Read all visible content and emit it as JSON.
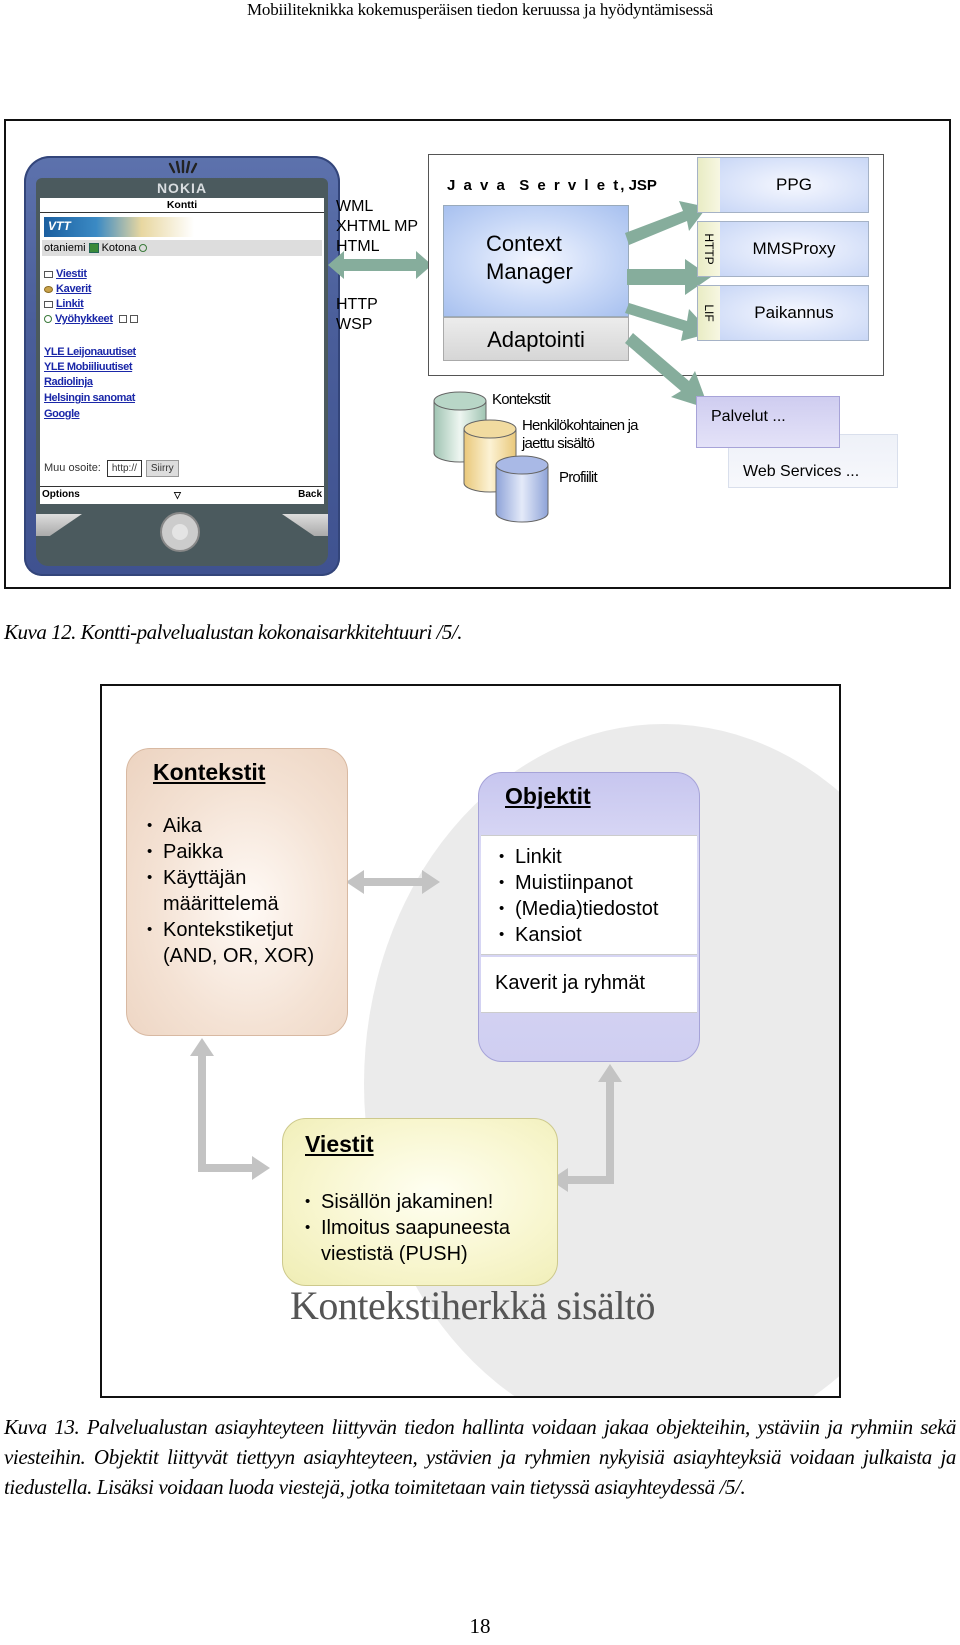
{
  "page": {
    "running_header": "Mobiiliteknikka kokemusperäisen tiedon keruussa ja hyödyntämisessä",
    "page_number": "18"
  },
  "figure12": {
    "phone": {
      "brand": "NOKIA",
      "screen_title": "Kontti",
      "logo": "VTT",
      "location": "otaniemi",
      "status": "Kotona",
      "menu": [
        {
          "label": "Viestit",
          "icon": "envelope-icon"
        },
        {
          "label": "Kaverit",
          "icon": "friends-icon"
        },
        {
          "label": "Linkit",
          "icon": "folder-icon"
        },
        {
          "label": "Vyöhykkeet",
          "icon": "zone-icon"
        }
      ],
      "links": [
        "YLE Leijonauutiset",
        "YLE Mobiiliuutiset",
        "Radiolinja",
        "Helsingin sanomat",
        "Google"
      ],
      "address_label": "Muu osoite:",
      "address_value": "http://",
      "go_button": "Siirry",
      "softkey_left": "Options",
      "softkey_right": "Back"
    },
    "protocols_top": [
      "WML",
      "XHTML MP",
      "HTML"
    ],
    "protocols_bottom": [
      "HTTP",
      "WSP"
    ],
    "servlet_title_spaced": "J a v a  S e r v l e t",
    "servlet_title_rest": ", JSP",
    "context_manager": [
      "Context",
      "Manager"
    ],
    "adaptointi": "Adaptointi",
    "services": [
      {
        "tab": "",
        "label": "PPG"
      },
      {
        "tab": "HTTP",
        "label": "MMSProxy"
      },
      {
        "tab": "LIF",
        "label": "Paikannus"
      }
    ],
    "databases": {
      "kontekstit": "Kontekstit",
      "sisalto": [
        "Henkilökohtainen ja",
        "jaettu sisältö"
      ],
      "profiilit": "Profiilit"
    },
    "palvelut": "Palvelut ...",
    "web_services": "Web Services ...",
    "caption": "Kuva 12. Kontti-palvelualustan kokonaisarkkitehtuuri /5/."
  },
  "figure13": {
    "kontekstit": {
      "title": "Kontekstit",
      "items": [
        "Aika",
        "Paikka",
        "Käyttäjän määrittelemä",
        "Kontekstiketjut (AND, OR, XOR)"
      ]
    },
    "objektit": {
      "title": "Objektit",
      "items": [
        "Linkit",
        "Muistiinpanot",
        "(Media)tiedostot",
        "Kansiot"
      ],
      "friends": "Kaverit ja ryhmät"
    },
    "viestit": {
      "title": "Viestit",
      "items": [
        "Sisällön jakaminen!",
        "Ilmoitus saapuneesta viestistä (PUSH)"
      ]
    },
    "background_label": "Kontekstiherkkä sisältö",
    "caption": "Kuva 13. Palvelualustan asiayhteyteen liittyvän tiedon hallinta voidaan jakaa objekteihin, ystäviin ja ryhmiin sekä viesteihin. Objektit liittyvät tiettyyn asiayhteyteen, ystävien ja ryhmien nykyisiä asiayhteyksiä voidaan julkaista ja tiedustella. Lisäksi voidaan luoda viestejä, jotka toimitetaan vain tietyssä asiayhteydessä /5/."
  },
  "colors": {
    "arrow_green": "#86ad9c",
    "arrow_gray": "#c3c3c3",
    "link_blue": "#1a27a8",
    "phone_blue": "#4a5e9a"
  }
}
